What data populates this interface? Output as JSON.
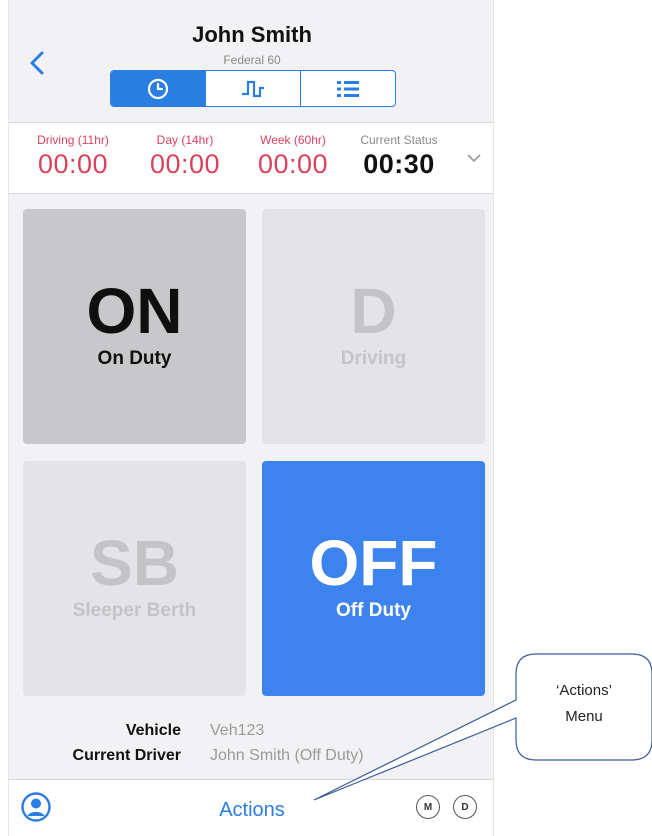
{
  "header": {
    "driver_name": "John Smith",
    "ruleset": "Federal 60",
    "tabs": [
      {
        "name": "clock-tab",
        "icon": "clock-icon",
        "active": true
      },
      {
        "name": "graph-tab",
        "icon": "log-graph-icon",
        "active": false
      },
      {
        "name": "list-tab",
        "icon": "list-icon",
        "active": false
      }
    ]
  },
  "clocks": [
    {
      "label": "Driving (11hr)",
      "value": "00:00"
    },
    {
      "label": "Day (14hr)",
      "value": "00:00"
    },
    {
      "label": "Week (60hr)",
      "value": "00:00"
    },
    {
      "label": "Current Status",
      "value": "00:30"
    }
  ],
  "statuses": {
    "on": {
      "code": "ON",
      "name": "On Duty",
      "state": "selected"
    },
    "d": {
      "code": "D",
      "name": "Driving",
      "state": "disabled"
    },
    "sb": {
      "code": "SB",
      "name": "Sleeper Berth",
      "state": "disabled"
    },
    "off": {
      "code": "OFF",
      "name": "Off Duty",
      "state": "current"
    }
  },
  "info": {
    "vehicle_label": "Vehicle",
    "vehicle_value": "Veh123",
    "driver_label": "Current Driver",
    "driver_value": "John Smith (Off Duty)"
  },
  "bottom": {
    "actions_label": "Actions",
    "badge_m": "M",
    "badge_d": "D"
  },
  "callout": {
    "line1": "‘Actions’",
    "line2": "Menu"
  },
  "colors": {
    "accent": "#2a7de1",
    "off_tile": "#3d83ee",
    "clock_red": "#d9435e"
  }
}
